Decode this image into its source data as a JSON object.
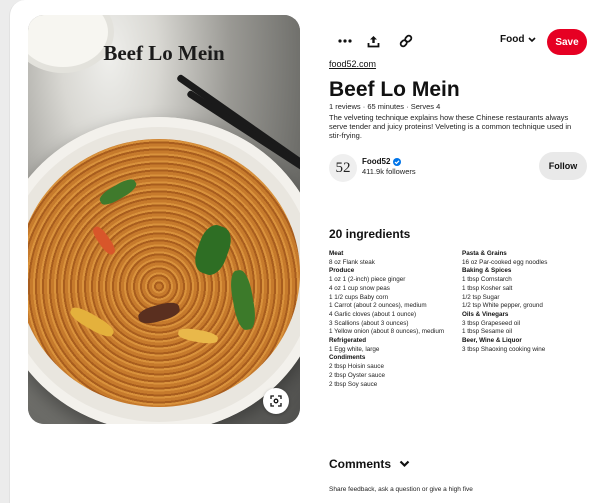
{
  "image": {
    "overlay_title": "Beef Lo Mein",
    "lens_icon": "visual-search-icon"
  },
  "toolbar": {
    "more_icon": "more-dots-icon",
    "share_icon": "share-upload-icon",
    "link_icon": "link-icon",
    "board_label": "Food",
    "board_chevron": "chevron-down-icon",
    "save_label": "Save",
    "save_color": "#e60023"
  },
  "pin": {
    "source_link": "food52.com",
    "title": "Beef Lo Mein",
    "meta": "1 reviews · 65 minutes · Serves 4",
    "description": "The velveting technique explains how these Chinese restaurants always serve tender and juicy proteins! Velveting is a common technique used in stir-frying."
  },
  "creator": {
    "avatar_text": "52",
    "name": "Food52",
    "verified_icon": "verified-badge-icon",
    "followers": "411.9k followers",
    "follow_label": "Follow"
  },
  "ingredients": {
    "heading": "20 ingredients",
    "left": [
      {
        "category": "Meat",
        "items": [
          "8 oz Flank steak"
        ]
      },
      {
        "category": "Produce",
        "items": [
          "1 oz 1 (2-inch) piece ginger",
          "4 oz 1 cup snow peas",
          "1 1/2 cups Baby corn",
          "1 Carrot (about 2 ounces), medium",
          "4 Garlic cloves (about 1 ounce)",
          "3 Scallions (about 3 ounces)",
          "1 Yellow onion (about 8 ounces), medium"
        ]
      },
      {
        "category": "Refrigerated",
        "items": [
          "1 Egg white, large"
        ]
      },
      {
        "category": "Condiments",
        "items": [
          "2 tbsp Hoisin sauce",
          "2 tbsp Oyster sauce",
          "2 tbsp Soy sauce"
        ]
      }
    ],
    "right": [
      {
        "category": "Pasta & Grains",
        "items": [
          "16 oz Par-cooked egg noodles"
        ]
      },
      {
        "category": "Baking & Spices",
        "items": [
          "1 tbsp Cornstarch",
          "1 tbsp Kosher salt",
          "1/2 tsp Sugar",
          "1/2 tsp White pepper, ground"
        ]
      },
      {
        "category": "Oils & Vinegars",
        "items": [
          "3 tbsp Grapeseed oil",
          "1 tbsp Sesame oil"
        ]
      },
      {
        "category": "Beer, Wine & Liquor",
        "items": [
          "3 tbsp Shaoxing cooking wine"
        ]
      }
    ]
  },
  "comments": {
    "heading": "Comments",
    "chevron": "chevron-down-icon",
    "prompt": "Share feedback, ask a question or give a high five"
  }
}
